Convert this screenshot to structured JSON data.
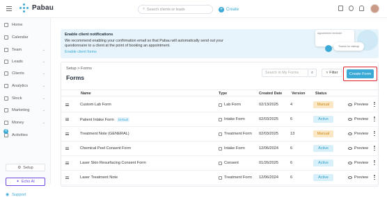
{
  "app": {
    "name": "Pabau"
  },
  "topbar": {
    "search_placeholder": "Search clients or leads",
    "create_label": "Create"
  },
  "sidebar": {
    "items": [
      {
        "label": "Home",
        "chevron": false
      },
      {
        "label": "Calendar",
        "chevron": false
      },
      {
        "label": "Team",
        "chevron": true
      },
      {
        "label": "Leads",
        "chevron": true
      },
      {
        "label": "Clients",
        "chevron": true
      },
      {
        "label": "Analytics",
        "chevron": true
      },
      {
        "label": "Stock",
        "chevron": true
      },
      {
        "label": "Marketing",
        "chevron": true
      },
      {
        "label": "Money",
        "chevron": true
      },
      {
        "label": "Activities",
        "chevron": false
      }
    ],
    "activities_badge": "4",
    "setup_label": "Setup",
    "echo_label": "Echo AI",
    "support_label": "Support"
  },
  "banner": {
    "title": "Enable client notifications",
    "text": "We recommend enabling your confirmation email so that Pabau will automatically send out your questionnaire to a client at the point of booking an appointment.",
    "link": "Enable client forms",
    "card1_text": "Appointment reminder",
    "card2_text": "Thanks for visiting!"
  },
  "page": {
    "breadcrumb_setup": "Setup",
    "breadcrumb_sep": ">",
    "breadcrumb_current": "Forms",
    "title": "Forms",
    "search_placeholder": "Search in My Forms",
    "filter_label": "Filter",
    "create_form_label": "Create Form"
  },
  "table": {
    "headers": {
      "name": "Name",
      "type": "Type",
      "created": "Created Date",
      "version": "Version",
      "status": "Status"
    },
    "rows": [
      {
        "name": "Custom Lab Form",
        "default": "",
        "type": "Lab Form",
        "created": "02/13/2025",
        "version": "4",
        "status": "Manual",
        "preview": "Preview"
      },
      {
        "name": "Patient Intake Form",
        "default": "Default",
        "type": "Intake Form",
        "created": "02/03/2025",
        "version": "6",
        "status": "Active",
        "preview": "Preview"
      },
      {
        "name": "Treatment Note (GENERAL)",
        "default": "",
        "type": "Treatment Form",
        "created": "02/03/2025",
        "version": "13",
        "status": "Manual",
        "preview": "Preview"
      },
      {
        "name": "Chemical Peel Consent Form",
        "default": "",
        "type": "Intake Form",
        "created": "12/06/2024",
        "version": "6",
        "status": "Active",
        "preview": "Preview"
      },
      {
        "name": "Laser Skin Resurfacing Consent Form",
        "default": "",
        "type": "Consent",
        "created": "01/26/2025",
        "version": "6",
        "status": "Active",
        "preview": "Preview"
      },
      {
        "name": "Laser Treatment Note",
        "default": "",
        "type": "Treatment Form",
        "created": "12/06/2024",
        "version": "6",
        "status": "Active",
        "preview": "Preview"
      }
    ]
  },
  "colors": {
    "accent": "#3aa9d6",
    "manual_bg": "#fbe7c4",
    "manual_fg": "#c98a1b",
    "active_bg": "#d8f0fa",
    "active_fg": "#2f9cc9",
    "highlight": "#e0202a"
  }
}
